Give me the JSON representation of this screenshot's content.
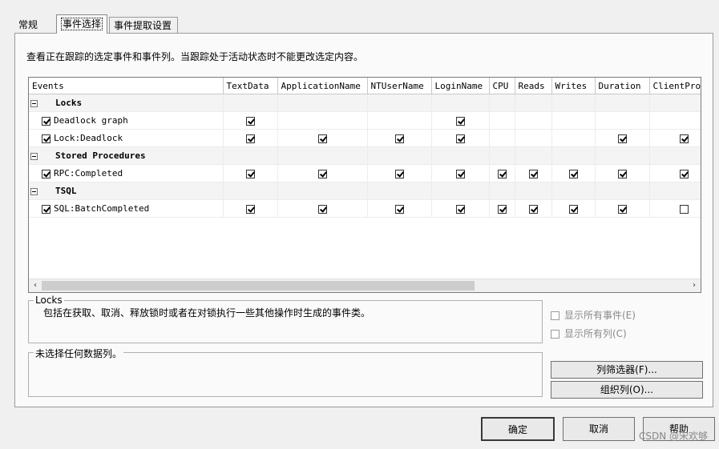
{
  "tabs": [
    "常规",
    "事件选择",
    "事件提取设置"
  ],
  "description": "查看正在跟踪的选定事件和事件列。当跟踪处于活动状态时不能更改选定内容。",
  "grid": {
    "columns": [
      "Events",
      "TextData",
      "ApplicationName",
      "NTUserName",
      "LoginName",
      "CPU",
      "Reads",
      "Writes",
      "Duration",
      "ClientProc"
    ],
    "categories": [
      {
        "name": "Locks",
        "events": [
          {
            "name": "Deadlock graph",
            "checked": [
              true,
              false,
              false,
              true,
              false,
              false,
              false,
              false,
              false
            ]
          },
          {
            "name": "Lock:Deadlock",
            "checked": [
              true,
              true,
              true,
              true,
              false,
              false,
              false,
              true,
              true
            ]
          }
        ]
      },
      {
        "name": "Stored Procedures",
        "events": [
          {
            "name": "RPC:Completed",
            "checked": [
              true,
              true,
              true,
              true,
              true,
              true,
              true,
              true,
              true
            ]
          }
        ]
      },
      {
        "name": "TSQL",
        "events": [
          {
            "name": "SQL:BatchCompleted",
            "checked": [
              true,
              true,
              true,
              true,
              true,
              true,
              true,
              true,
              false
            ]
          }
        ]
      }
    ]
  },
  "locks_group": {
    "legend": "Locks",
    "text": "包括在获取、取消、释放锁时或者在对锁执行一些其他操作时生成的事件类。"
  },
  "columns_group": {
    "legend": "未选择任何数据列。"
  },
  "options": {
    "show_all_events": "显示所有事件(E)",
    "show_all_columns": "显示所有列(C)"
  },
  "buttons": {
    "column_filter": "列筛选器(F)...",
    "organize_columns": "组织列(O)...",
    "ok": "确定",
    "cancel": "取消",
    "help": "帮助"
  },
  "watermark": "CSDN @宋欢够"
}
